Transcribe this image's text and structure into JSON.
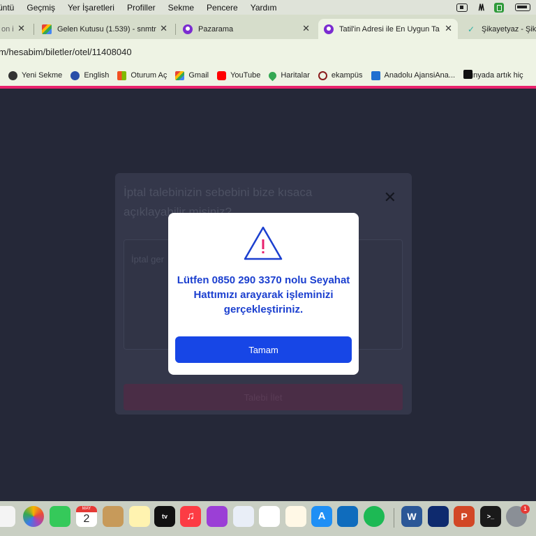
{
  "menubar": {
    "items": [
      "üntü",
      "Geçmiş",
      "Yer İşaretleri",
      "Profiller",
      "Sekme",
      "Pencere",
      "Yardım"
    ]
  },
  "tabs": [
    {
      "label": "on i",
      "active": false
    },
    {
      "label": "Gelen Kutusu (1.539) - snmtr",
      "active": false
    },
    {
      "label": "Pazarama",
      "active": false
    },
    {
      "label": "Tatil'in Adresi ile En Uygun Ta",
      "active": true
    },
    {
      "label": "Şikayetyaz - Şika",
      "active": false
    }
  ],
  "address": {
    "url": "m/hesabim/biletler/otel/11408040"
  },
  "bookmarks": [
    {
      "label": "Yeni Sekme",
      "icon": "globe-icon"
    },
    {
      "label": "English",
      "icon": "globe-icon"
    },
    {
      "label": "Oturum Aç",
      "icon": "microsoft-icon"
    },
    {
      "label": "Gmail",
      "icon": "gmail-icon"
    },
    {
      "label": "YouTube",
      "icon": "youtube-icon"
    },
    {
      "label": "Haritalar",
      "icon": "maps-icon"
    },
    {
      "label": "ekampüs",
      "icon": "ekampus-icon"
    },
    {
      "label": "Anadolu AjansiAna...",
      "icon": "aa-icon"
    },
    {
      "label": "Dünyada artık hiç",
      "icon": "news-icon"
    }
  ],
  "background_modal": {
    "title": "İptal talebinizin sebebini bize kısaca açıklayabilir misiniz?",
    "placeholder": "İptal ger",
    "send_label": "Talebi İlet"
  },
  "alert": {
    "message": "Lütfen 0850 290 3370 nolu Seyahat Hattımızı arayarak işleminizi gerçekleştiriniz.",
    "ok_label": "Tamam",
    "icon": "warning-triangle-icon",
    "colors": {
      "accent": "#1746e6",
      "text": "#1b3fcf",
      "icon_mark": "#e8216c"
    }
  },
  "dock": {
    "calendar_month": "MAY",
    "calendar_day": "2",
    "badge": "1"
  }
}
